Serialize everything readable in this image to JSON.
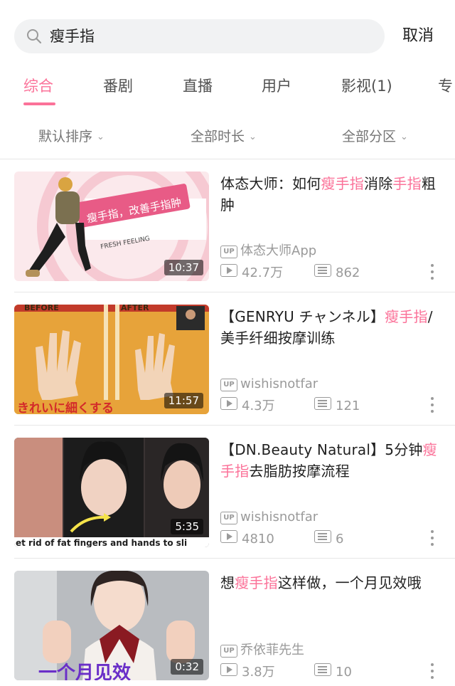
{
  "search": {
    "query": "瘦手指",
    "cancel_label": "取消"
  },
  "tabs": [
    "综合",
    "番剧",
    "直播",
    "用户",
    "影视(1)",
    "专"
  ],
  "filters": [
    "默认排序",
    "全部时长",
    "全部分区"
  ],
  "colors": {
    "accent": "#fb7299",
    "text": "#212121",
    "meta": "#9a9a9a"
  },
  "videos": [
    {
      "title_parts": [
        "体态大师：如何",
        "瘦手指",
        "消除",
        "手指",
        "粗肿"
      ],
      "uploader": "体态大师App",
      "views": "42.7万",
      "danmaku": "862",
      "duration": "10:37",
      "thumb_text": [
        "瘦手指，改善手指肿",
        "FRESH FEELING"
      ]
    },
    {
      "title_parts": [
        "【GENRYU チャンネル】",
        "瘦手指",
        "/美手纤细按摩训练"
      ],
      "uploader": "wishisnotfar",
      "views": "4.3万",
      "danmaku": "121",
      "duration": "11:57",
      "thumb_text": [
        "BEFORE",
        "AFTER",
        "きれいに細くする"
      ]
    },
    {
      "title_parts": [
        "【DN.Beauty Natural】5分钟",
        "瘦手指",
        "去脂肪按摩流程"
      ],
      "uploader": "wishisnotfar",
      "views": "4810",
      "danmaku": "6",
      "duration": "5:35",
      "thumb_text": [
        "et rid of fat fingers and hands to sli"
      ]
    },
    {
      "title_parts": [
        "想",
        "瘦手指",
        "这样做，一个月见效哦"
      ],
      "uploader": "乔依菲先生",
      "views": "3.8万",
      "danmaku": "10",
      "duration": "0:32",
      "thumb_text": [
        "一个月见效"
      ]
    }
  ],
  "icons": {
    "search": "magnifier-icon",
    "up": "up-badge-icon",
    "play": "play-count-icon",
    "danmaku": "danmaku-icon",
    "more": "more-vertical-icon"
  }
}
